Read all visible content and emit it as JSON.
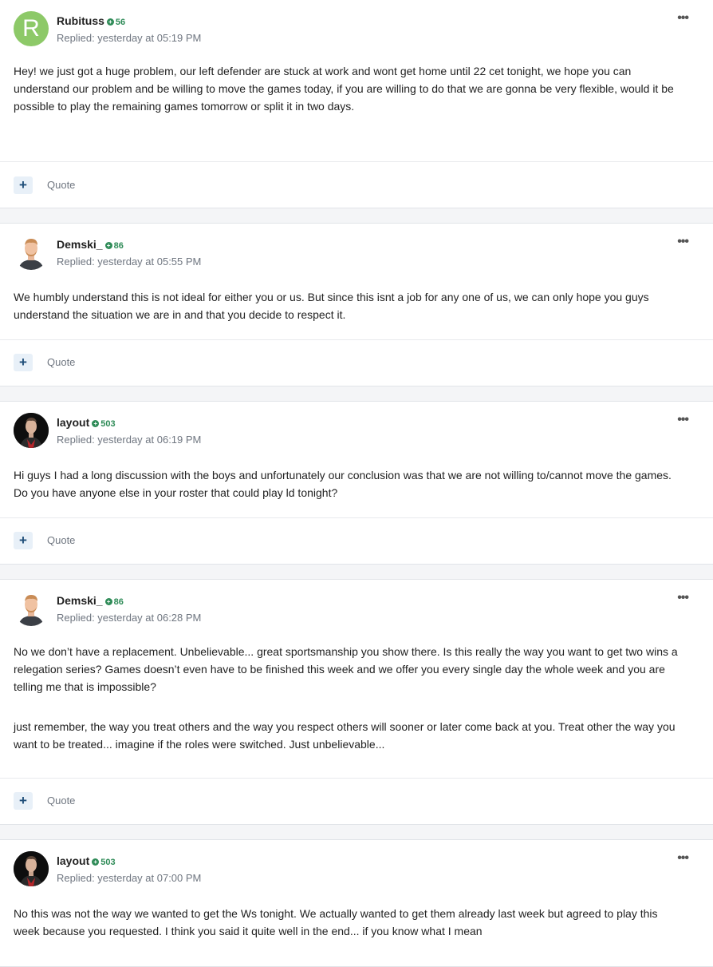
{
  "posts": [
    {
      "username": "Rubituss",
      "rep": "56",
      "avatar_letter": "R",
      "meta": "Replied: yesterday at 05:19 PM",
      "paragraphs": [
        "Hey! we just got a huge problem, our left defender are stuck at work and wont get home until 22 cet tonight, we hope you can understand our problem and be willing  to move the games today, if you are willing to do that we are gonna be very flexible, would it be possible to play the remaining games tomorrow or split it in two days."
      ],
      "quote_label": "Quote",
      "plus_icon": "plus-icon",
      "menu_icon": "ellipsis-icon"
    },
    {
      "username": "Demski_",
      "rep": "86",
      "meta": "Replied: yesterday at 05:55 PM",
      "paragraphs": [
        "We humbly understand this is not ideal for either you or us. But since this isnt a job for any one of us, we can only hope you guys understand the situation we are in and that you decide to respect it."
      ],
      "quote_label": "Quote"
    },
    {
      "username": "layout",
      "rep": "503",
      "meta": "Replied: yesterday at 06:19 PM",
      "paragraphs": [
        "Hi guys I had a long discussion with the boys and unfortunately our conclusion was that we are not willing to/cannot move the games. Do you have anyone else in your roster that could play ld tonight?"
      ],
      "quote_label": "Quote"
    },
    {
      "username": "Demski_",
      "rep": "86",
      "meta": "Replied: yesterday at 06:28 PM",
      "paragraphs": [
        "No we don’t have a replacement. Unbelievable... great sportsmanship you show there. Is this really the way you want to get two wins a relegation series? Games doesn’t even have to be finished this week and we offer you every single day the whole week and you are telling me that is impossible?",
        "just remember, the way you treat others and the way you respect others will sooner or later come back at you. Treat other the way you want to be treated... imagine if the roles were switched. Just unbelievable..."
      ],
      "quote_label": "Quote"
    },
    {
      "username": "layout",
      "rep": "503",
      "meta": "Replied: yesterday at 07:00 PM",
      "paragraphs": [
        "No this was not the way we wanted to get the Ws tonight. We actually wanted to get them already last week but agreed to play this week because you requested. I think you said it quite well in the end... if you know what I mean"
      ]
    }
  ],
  "colors": {
    "reputation": "#2e8b57",
    "avatar_bg": "#8dc968",
    "plus_button_bg": "#e8f0f8"
  }
}
